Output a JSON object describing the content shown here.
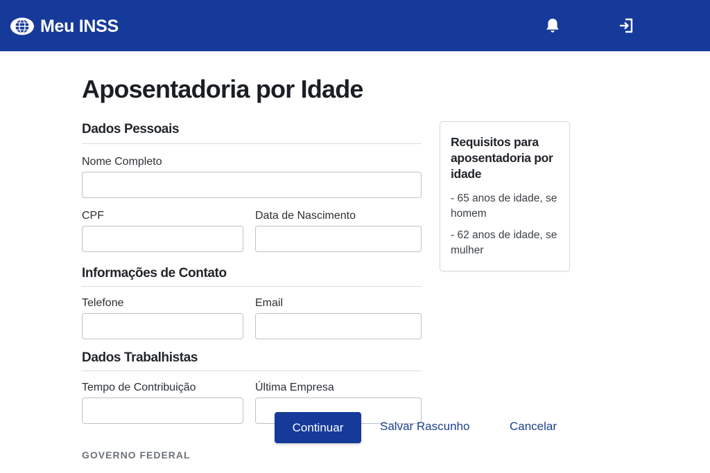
{
  "header": {
    "app_title": "Meu INSS",
    "icons": [
      "globe-logo-icon",
      "bell-icon",
      "logout-icon"
    ],
    "color": "#163a99"
  },
  "page_title": "Aposentadoria por Idade",
  "form": {
    "personal": {
      "title": "Dados Pessoais",
      "full_name_label": "Nome Completo",
      "full_name_value": "",
      "cpf_label": "CPF",
      "cpf_value": "",
      "birth_date_label": "Data de Nascimento",
      "birth_date_value": ""
    },
    "contact": {
      "title": "Informações de Contato",
      "phone_label": "Telefone",
      "phone_value": "",
      "email_label": "Email",
      "email_value": ""
    },
    "work": {
      "title": "Dados Trabalhistas",
      "contribution_label": "Tempo de Contribuição",
      "contribution_value": "",
      "last_company_label": "Última Empresa",
      "last_company_value": ""
    }
  },
  "requirements": {
    "title": "Requisitos para aposentadoria por idade",
    "items": [
      "- 65 anos de idade, se homem",
      "- 62 anos de idade, se mulher"
    ]
  },
  "actions": {
    "continue_label": "Continuar",
    "save_draft_label": "Salvar Rascunho",
    "cancel_label": "Cancelar"
  },
  "footer": {
    "brand": "GOVERNO FEDERAL"
  }
}
